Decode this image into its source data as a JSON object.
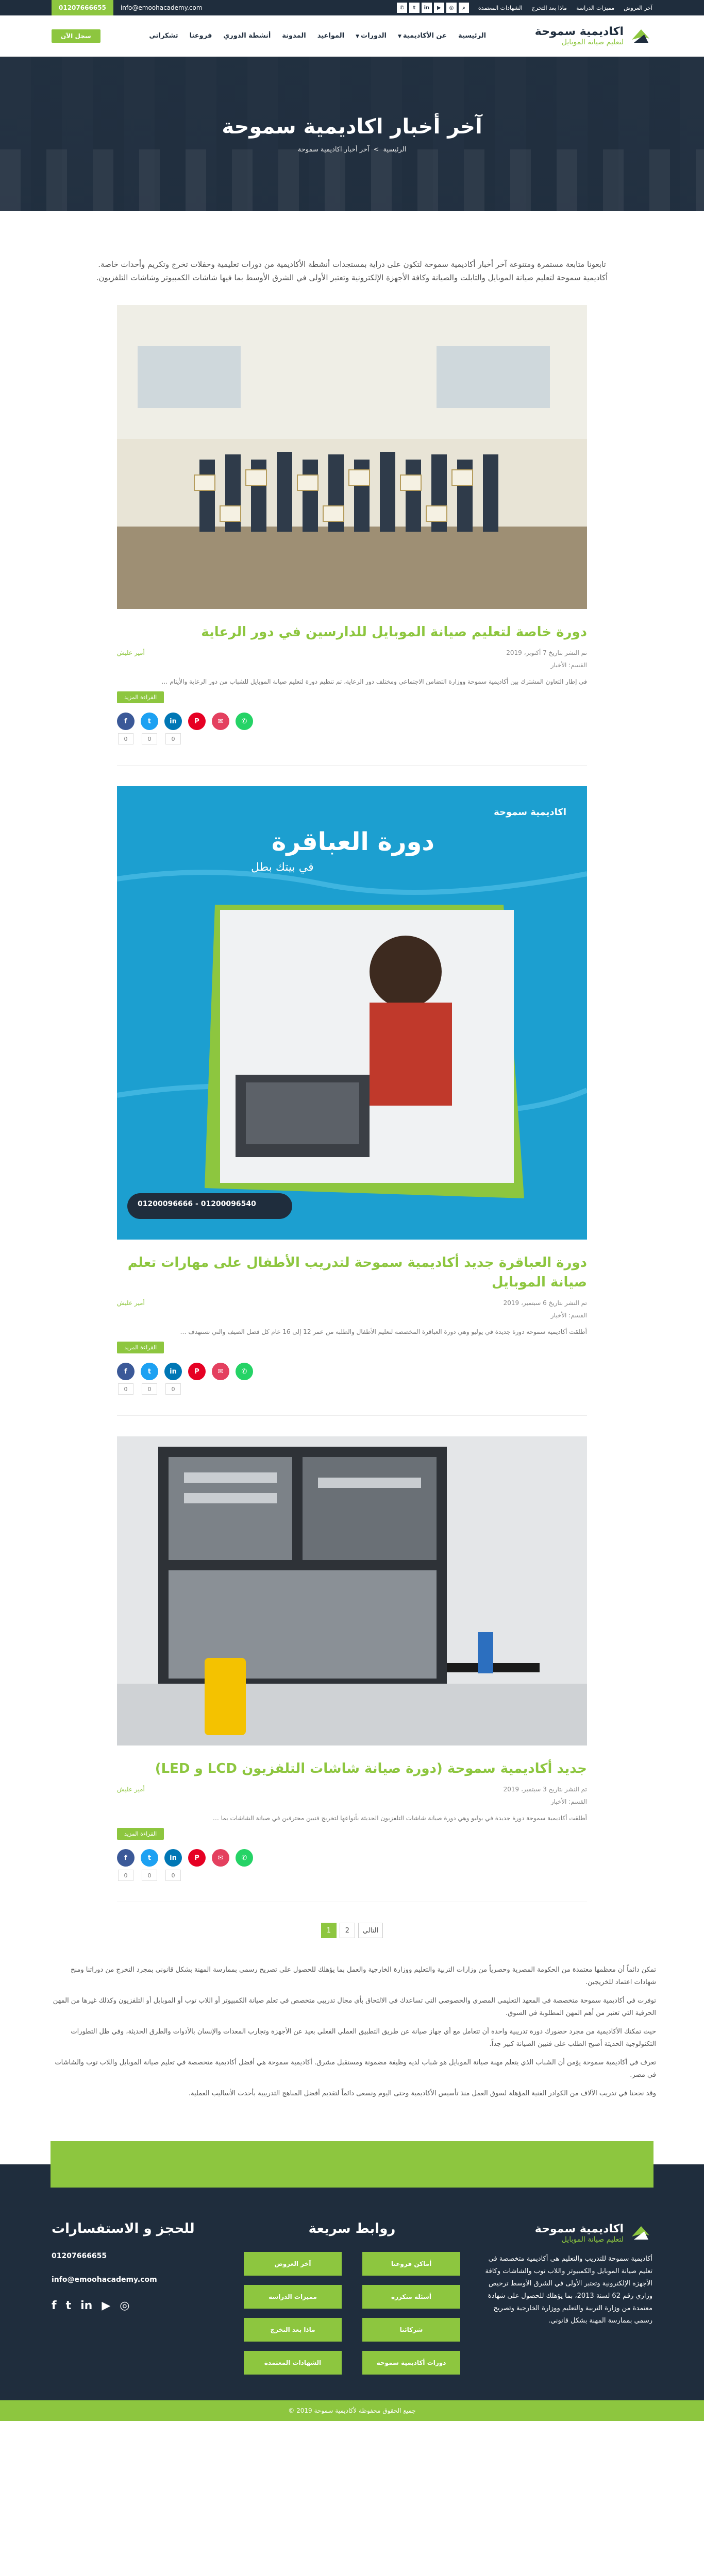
{
  "topbar": {
    "phone": "01207666655",
    "email": "info@emoohacademy.com",
    "links": [
      "آخر العروض",
      "مميزات الدراسة",
      "ماذا بعد التخرج",
      "الشهادات المعتمدة"
    ],
    "social_icons": [
      "whatsapp-icon",
      "twitter-icon",
      "youtube-icon",
      "instagram-icon",
      "linkedin-icon"
    ],
    "search_icon": "search-icon"
  },
  "header": {
    "logo_title": "اكاديمية سموحة",
    "logo_sub": "لتعليم صيانة الموبايل",
    "nav": [
      "الرئيسية",
      "عن الأكاديمية",
      "الدورات",
      "المواعيد",
      "المدونة",
      "أنشطة الدوري",
      "فروعنا",
      "تشكراتي"
    ],
    "register_label": "سجل الآن"
  },
  "hero": {
    "title": "آخر أخبار اكاديمية سموحة",
    "breadcrumb_home": "الرئيسية",
    "breadcrumb_sep": ">",
    "breadcrumb_current": "آخر أخبار اكاديمية سموحة"
  },
  "intro": "تابعونا متابعة مستمرة ومتنوعة آخر أخبار أكاديمية سموحة لتكون على دراية بمستجدات أنشطة الأكاديمية من دورات تعليمية وحفلات تخرج وتكريم وأحداث خاصة. أكاديمية سموحة لتعليم صيانة الموبايل والتابلت والصيانة وكافة الأجهزة الإلكترونية وتعتبر الأولى في الشرق الأوسط بما فيها شاشات الكمبيوتر وشاشات التلفزيون.",
  "posts": [
    {
      "title": "دورة خاصة لتعليم صيانة الموبايل للدارسين في دور الرعاية",
      "date": "تم النشر بتاريخ 7 أكتوبر، 2019",
      "author": "أمير عليش",
      "category": "القسم: الأخبار",
      "excerpt": "في إطار التعاون المشترك بين أكاديمية سموحة ووزارة التضامن الاجتماعي ومختلف دور الرعاية، تم تنظيم دورة لتعليم صيانة الموبايل للشباب من دور الرعاية والأيتام …",
      "more_label": "القراءة المزيد",
      "shares": [
        "0",
        "0",
        "0"
      ]
    },
    {
      "title": "دورة العباقرة جديد أكاديمية سموحة لتدريب الأطفال على مهارات تعلم صيانة الموبايل",
      "date": "تم النشر بتاريخ 6 سبتمبر، 2019",
      "author": "أمير عليش",
      "category": "القسم: الأخبار",
      "excerpt": "أطلقت أكاديمية سموحة دورة جديدة في يوليو وهي دورة العباقرة المخصصة لتعليم الأطفال والطلبة من عمر 12 إلى 16 عام كل فصل الصيف والتي تستهدف …",
      "more_label": "القراءة المزيد",
      "shares": [
        "0",
        "0",
        "0"
      ],
      "promo_title": "دورة العباقرة",
      "promo_sub": "في بيتك بطل",
      "promo_logo": "اكاديمية سموحة",
      "promo_phones": "01200096666 - 01200096540"
    },
    {
      "title": "جديد أكاديمية سموحة (دورة صيانة شاشات التلفزيون LCD و LED)",
      "date": "تم النشر بتاريخ 3 سبتمبر، 2019",
      "author": "أمير عليش",
      "category": "القسم: الأخبار",
      "excerpt": "أطلقت أكاديمية سموحة دورة جديدة في يوليو وهي دورة صيانة شاشات التلفزيون الحديثة بأنواعها لتخريج فنيين محترفين في صيانة الشاشات بما …",
      "more_label": "القراءة المزيد",
      "shares": [
        "0",
        "0",
        "0"
      ]
    }
  ],
  "share_icons": [
    {
      "name": "facebook-icon",
      "glyph": "f",
      "color": "#3b5998"
    },
    {
      "name": "twitter-icon",
      "glyph": "t",
      "color": "#1da1f2"
    },
    {
      "name": "linkedin-icon",
      "glyph": "in",
      "color": "#0077b5"
    },
    {
      "name": "pinterest-icon",
      "glyph": "P",
      "color": "#e60023"
    },
    {
      "name": "email-icon",
      "glyph": "✉",
      "color": "#e4405f"
    },
    {
      "name": "whatsapp-icon",
      "glyph": "✆",
      "color": "#25d366"
    }
  ],
  "pagination": {
    "pages": [
      "1",
      "2"
    ],
    "next": "التالي",
    "active": "1"
  },
  "seo": [
    "تمكن دائماً أن معظمها معتمدة من الحكومة المصرية وحصرياً من وزارات التربية والتعليم ووزارة الخارجية والعمل بما يؤهلك للحصول على تصريح رسمي بممارسة المهنة بشكل قانوني بمجرد التخرج من دوراتنا ومنح شهادات اعتماد للخريجين.",
    "توفرت في أكاديمية سموحة متخصصة في المعهد التعليمي المصري والخصوصي التي تساعدك في الالتحاق بأي مجال تدريبي متخصص في تعلم صيانة الكمبيوتر أو اللاب توب أو الموبايل أو التلفزيون وكذلك غيرها من المهن الحرفية التي تعتبر من أهم المهن المطلوبة في السوق.",
    "حيث تمكنك الأكاديمية من مجرد حضورك دورة تدريبية واحدة أن تتعامل مع أي جهاز صيانة عن طريق التطبيق العملي الفعلي بعيد عن الأجهزة وتجارب المعدات والإنسان بالأدوات والطرق الحديثة، وفي ظل التطورات التكنولوجية الحديثة أصبح الطلب على فنيين الصيانة كبير جداً.",
    "تعرف في أكاديمية سموحة يؤمن أن الشباب الذي يتعلم مهنة صيانة الموبايل هو شباب لديه وظيفة مضمونة ومستقبل مشرق. أكاديمية سموحة هي أفضل أكاديمية متخصصة في تعليم صيانة الموبايل واللاب توب والشاشات في مصر.",
    "وقد نجحنا في تدريب الآلاف من الكوادر الفنية المؤهلة لسوق العمل منذ تأسيس الأكاديمية وحتى اليوم ونسعى دائماً لتقديم أفضل المناهج التدريبية بأحدث الأساليب العملية."
  ],
  "footer": {
    "logo_title": "اكاديمية سموحة",
    "logo_sub": "لتعليم صيانة الموبايل",
    "about": "أكاديمية سموحة للتدريب والتعليم هي أكاديمية متخصصة في تعليم صيانة الموبايل والكمبيوتر واللاب توب والشاشات وكافة الأجهزة الإلكترونية وتعتبر الأولى في الشرق الأوسط ترخيص وزاري رقم 62 لسنة 2013، بما يؤهلك للحصول على شهادة معتمدة من وزارة التربية والتعليم ووزارة الخارجية وتصريح رسمي بممارسة المهنة بشكل قانوني.",
    "links_heading": "روابط سريعة",
    "links": [
      "أماكن فروعنا",
      "آخر العروض",
      "أسئلة متكررة",
      "مميزات الدراسة",
      "شركائنا",
      "ماذا بعد التخرج",
      "دورات أكاديمية سموحة",
      "الشهادات المعتمدة"
    ],
    "contact_heading": "للحجز و الاستفسارات",
    "phone": "01207666655",
    "email": "info@emoohacademy.com",
    "social": [
      "facebook-icon",
      "twitter-icon",
      "linkedin-icon",
      "youtube-icon",
      "instagram-icon"
    ],
    "copyright": "جميع الحقوق محفوظة لأكاديمية سموحة 2019 ©"
  }
}
